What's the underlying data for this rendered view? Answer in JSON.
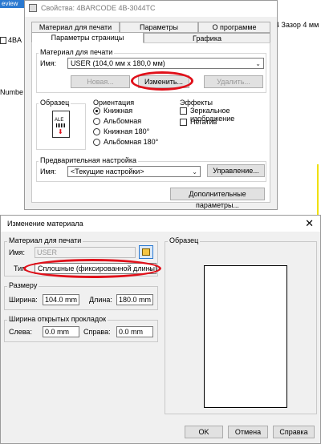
{
  "background": {
    "top_left_text": "eview",
    "left_item1": "4BA",
    "left_item2": "Numbe",
    "right_text": "4 Зазор 4 мм"
  },
  "dialog1": {
    "title": "Свойства: 4BARCODE 4B-3044TC",
    "tabs_row1": [
      "Материал для печати",
      "Параметры",
      "О программе"
    ],
    "tabs_row2": [
      "Параметры страницы",
      "Графика"
    ],
    "media_group": {
      "label": "Материал для печати",
      "name_label": "Имя:",
      "name_value": "USER (104,0 мм x 180,0 мм)",
      "new_button": "Новая...",
      "edit_button": "Изменить...",
      "delete_button": "Удалить..."
    },
    "sample": {
      "label": "Образец",
      "icon_text": "ALE"
    },
    "orientation": {
      "label": "Ориентация",
      "options": [
        "Книжная",
        "Альбомная",
        "Книжная 180°",
        "Альбомная 180°"
      ],
      "selected_index": 0
    },
    "effects": {
      "label": "Эффекты",
      "mirror": "Зеркальное изображение",
      "negative": "Негатив"
    },
    "preset": {
      "label": "Предварительная настройка",
      "name_label": "Имя:",
      "name_value": "<Текущие настройки>",
      "manage_button": "Управление..."
    },
    "advanced_button": "Дополнительные параметры..."
  },
  "dialog2": {
    "title": "Изменение материала",
    "close_glyph": "✕",
    "media_group": {
      "label": "Материал для печати",
      "name_label": "Имя:",
      "name_value": "USER",
      "type_label": "Тип",
      "type_value": "Сплошные (фиксированной длины)"
    },
    "size_group": {
      "label": "Размеру",
      "width_label": "Ширина:",
      "width_value": "104.0 mm",
      "length_label": "Длина:",
      "length_value": "180.0 mm"
    },
    "gap_group": {
      "label": "Ширина открытых прокладок",
      "left_label": "Слева:",
      "left_value": "0.0 mm",
      "right_label": "Справа:",
      "right_value": "0.0 mm"
    },
    "preview_label": "Образец",
    "ok_button": "OK",
    "cancel_button": "Отмена",
    "help_button": "Справка"
  },
  "colors": {
    "annotation_red": "#e0101a",
    "accent_blue": "#2b79d0"
  }
}
